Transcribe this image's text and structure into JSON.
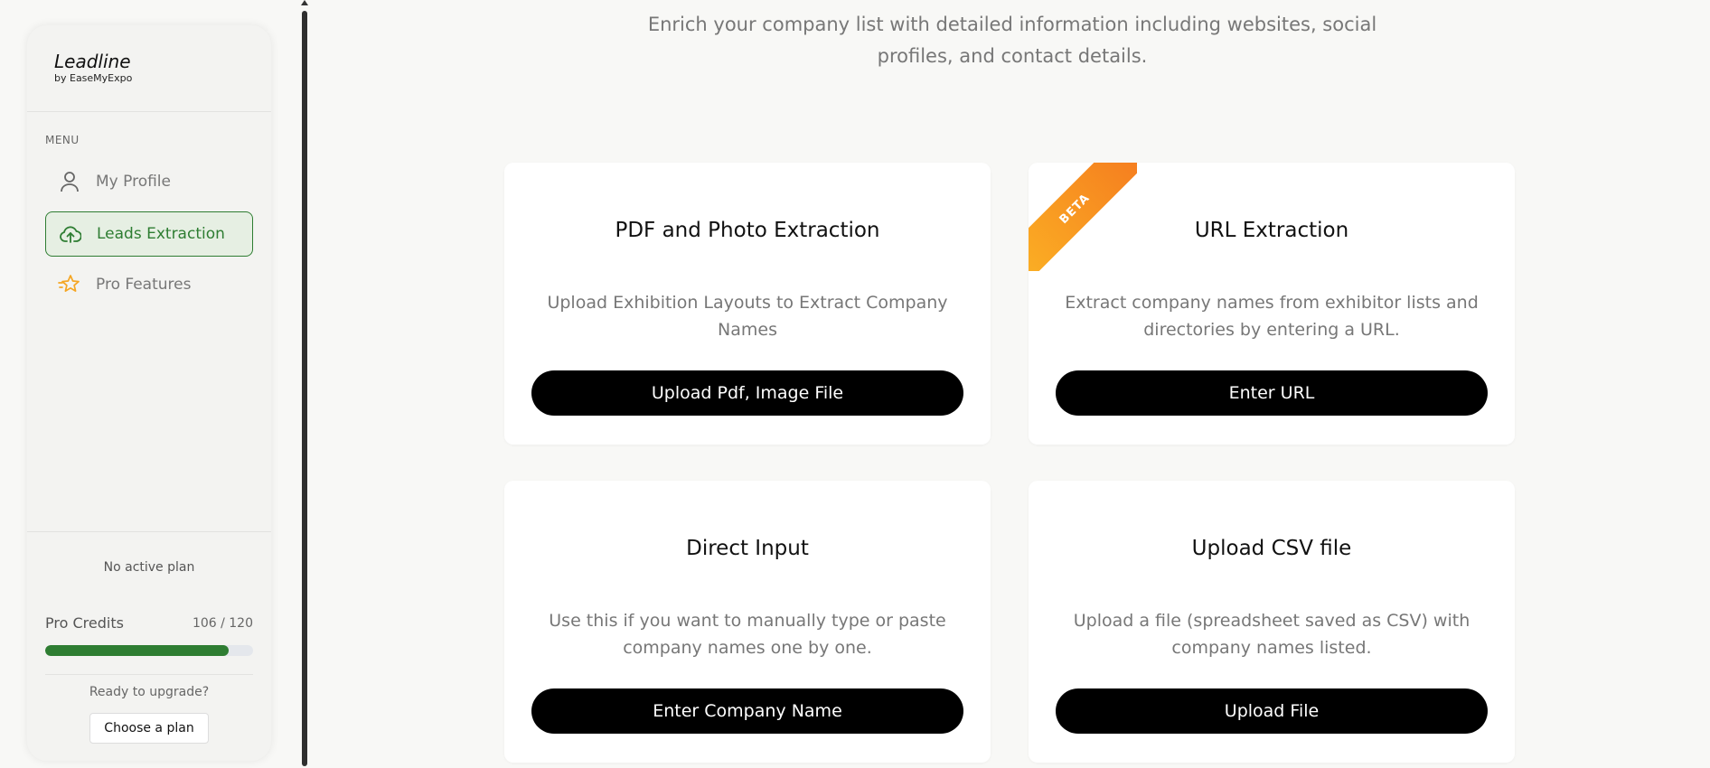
{
  "brand": {
    "name": "Leadline",
    "byline": "by EaseMyExpo"
  },
  "sidebar": {
    "menu_label": "MENU",
    "items": [
      {
        "label": "My Profile",
        "icon": "user-icon",
        "active": false
      },
      {
        "label": "Leads Extraction",
        "icon": "upload-cloud-icon",
        "active": true
      },
      {
        "label": "Pro Features",
        "icon": "star-icon",
        "active": false
      }
    ],
    "plan_status": "No active plan",
    "credits": {
      "label": "Pro Credits",
      "count_text": "106 / 120",
      "used": 106,
      "total": 120
    },
    "upgrade_text": "Ready to upgrade?",
    "choose_plan_label": "Choose a plan"
  },
  "main": {
    "intro": "Enrich your company list with detailed information including websites, social profiles, and contact details.",
    "cards": [
      {
        "title": "PDF and Photo Extraction",
        "description": "Upload Exhibition Layouts to Extract Company Names",
        "button": "Upload Pdf, Image File"
      },
      {
        "title": "URL Extraction",
        "description": "Extract company names from exhibitor lists and directories by entering a URL.",
        "button": "Enter URL",
        "badge": "BETA"
      },
      {
        "title": "Direct Input",
        "description": "Use this if you want to manually type or paste company names one by one.",
        "button": "Enter Company Name"
      },
      {
        "title": "Upload CSV file",
        "description": "Upload a file (spreadsheet saved as CSV) with company names listed.",
        "button": "Upload File"
      }
    ]
  },
  "colors": {
    "accent_green": "#2e7d32",
    "active_bg": "#e6efe3",
    "star_orange": "#f5a623",
    "ribbon_start": "#fbb024",
    "ribbon_end": "#f57c1f",
    "button_black": "#000000"
  }
}
